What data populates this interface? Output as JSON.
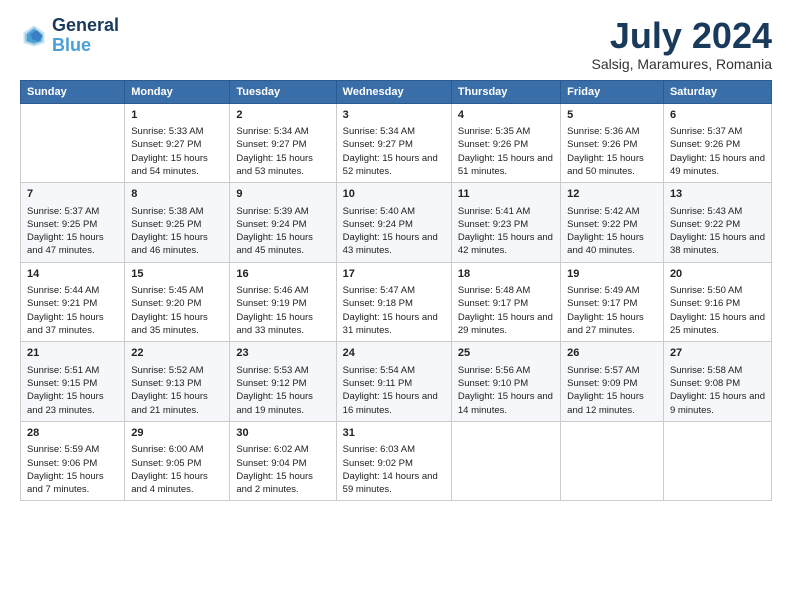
{
  "header": {
    "logo_line1": "General",
    "logo_line2": "Blue",
    "month": "July 2024",
    "location": "Salsig, Maramures, Romania"
  },
  "days_of_week": [
    "Sunday",
    "Monday",
    "Tuesday",
    "Wednesday",
    "Thursday",
    "Friday",
    "Saturday"
  ],
  "weeks": [
    [
      {
        "day": "",
        "sunrise": "",
        "sunset": "",
        "daylight": ""
      },
      {
        "day": "1",
        "sunrise": "Sunrise: 5:33 AM",
        "sunset": "Sunset: 9:27 PM",
        "daylight": "Daylight: 15 hours and 54 minutes."
      },
      {
        "day": "2",
        "sunrise": "Sunrise: 5:34 AM",
        "sunset": "Sunset: 9:27 PM",
        "daylight": "Daylight: 15 hours and 53 minutes."
      },
      {
        "day": "3",
        "sunrise": "Sunrise: 5:34 AM",
        "sunset": "Sunset: 9:27 PM",
        "daylight": "Daylight: 15 hours and 52 minutes."
      },
      {
        "day": "4",
        "sunrise": "Sunrise: 5:35 AM",
        "sunset": "Sunset: 9:26 PM",
        "daylight": "Daylight: 15 hours and 51 minutes."
      },
      {
        "day": "5",
        "sunrise": "Sunrise: 5:36 AM",
        "sunset": "Sunset: 9:26 PM",
        "daylight": "Daylight: 15 hours and 50 minutes."
      },
      {
        "day": "6",
        "sunrise": "Sunrise: 5:37 AM",
        "sunset": "Sunset: 9:26 PM",
        "daylight": "Daylight: 15 hours and 49 minutes."
      }
    ],
    [
      {
        "day": "7",
        "sunrise": "Sunrise: 5:37 AM",
        "sunset": "Sunset: 9:25 PM",
        "daylight": "Daylight: 15 hours and 47 minutes."
      },
      {
        "day": "8",
        "sunrise": "Sunrise: 5:38 AM",
        "sunset": "Sunset: 9:25 PM",
        "daylight": "Daylight: 15 hours and 46 minutes."
      },
      {
        "day": "9",
        "sunrise": "Sunrise: 5:39 AM",
        "sunset": "Sunset: 9:24 PM",
        "daylight": "Daylight: 15 hours and 45 minutes."
      },
      {
        "day": "10",
        "sunrise": "Sunrise: 5:40 AM",
        "sunset": "Sunset: 9:24 PM",
        "daylight": "Daylight: 15 hours and 43 minutes."
      },
      {
        "day": "11",
        "sunrise": "Sunrise: 5:41 AM",
        "sunset": "Sunset: 9:23 PM",
        "daylight": "Daylight: 15 hours and 42 minutes."
      },
      {
        "day": "12",
        "sunrise": "Sunrise: 5:42 AM",
        "sunset": "Sunset: 9:22 PM",
        "daylight": "Daylight: 15 hours and 40 minutes."
      },
      {
        "day": "13",
        "sunrise": "Sunrise: 5:43 AM",
        "sunset": "Sunset: 9:22 PM",
        "daylight": "Daylight: 15 hours and 38 minutes."
      }
    ],
    [
      {
        "day": "14",
        "sunrise": "Sunrise: 5:44 AM",
        "sunset": "Sunset: 9:21 PM",
        "daylight": "Daylight: 15 hours and 37 minutes."
      },
      {
        "day": "15",
        "sunrise": "Sunrise: 5:45 AM",
        "sunset": "Sunset: 9:20 PM",
        "daylight": "Daylight: 15 hours and 35 minutes."
      },
      {
        "day": "16",
        "sunrise": "Sunrise: 5:46 AM",
        "sunset": "Sunset: 9:19 PM",
        "daylight": "Daylight: 15 hours and 33 minutes."
      },
      {
        "day": "17",
        "sunrise": "Sunrise: 5:47 AM",
        "sunset": "Sunset: 9:18 PM",
        "daylight": "Daylight: 15 hours and 31 minutes."
      },
      {
        "day": "18",
        "sunrise": "Sunrise: 5:48 AM",
        "sunset": "Sunset: 9:17 PM",
        "daylight": "Daylight: 15 hours and 29 minutes."
      },
      {
        "day": "19",
        "sunrise": "Sunrise: 5:49 AM",
        "sunset": "Sunset: 9:17 PM",
        "daylight": "Daylight: 15 hours and 27 minutes."
      },
      {
        "day": "20",
        "sunrise": "Sunrise: 5:50 AM",
        "sunset": "Sunset: 9:16 PM",
        "daylight": "Daylight: 15 hours and 25 minutes."
      }
    ],
    [
      {
        "day": "21",
        "sunrise": "Sunrise: 5:51 AM",
        "sunset": "Sunset: 9:15 PM",
        "daylight": "Daylight: 15 hours and 23 minutes."
      },
      {
        "day": "22",
        "sunrise": "Sunrise: 5:52 AM",
        "sunset": "Sunset: 9:13 PM",
        "daylight": "Daylight: 15 hours and 21 minutes."
      },
      {
        "day": "23",
        "sunrise": "Sunrise: 5:53 AM",
        "sunset": "Sunset: 9:12 PM",
        "daylight": "Daylight: 15 hours and 19 minutes."
      },
      {
        "day": "24",
        "sunrise": "Sunrise: 5:54 AM",
        "sunset": "Sunset: 9:11 PM",
        "daylight": "Daylight: 15 hours and 16 minutes."
      },
      {
        "day": "25",
        "sunrise": "Sunrise: 5:56 AM",
        "sunset": "Sunset: 9:10 PM",
        "daylight": "Daylight: 15 hours and 14 minutes."
      },
      {
        "day": "26",
        "sunrise": "Sunrise: 5:57 AM",
        "sunset": "Sunset: 9:09 PM",
        "daylight": "Daylight: 15 hours and 12 minutes."
      },
      {
        "day": "27",
        "sunrise": "Sunrise: 5:58 AM",
        "sunset": "Sunset: 9:08 PM",
        "daylight": "Daylight: 15 hours and 9 minutes."
      }
    ],
    [
      {
        "day": "28",
        "sunrise": "Sunrise: 5:59 AM",
        "sunset": "Sunset: 9:06 PM",
        "daylight": "Daylight: 15 hours and 7 minutes."
      },
      {
        "day": "29",
        "sunrise": "Sunrise: 6:00 AM",
        "sunset": "Sunset: 9:05 PM",
        "daylight": "Daylight: 15 hours and 4 minutes."
      },
      {
        "day": "30",
        "sunrise": "Sunrise: 6:02 AM",
        "sunset": "Sunset: 9:04 PM",
        "daylight": "Daylight: 15 hours and 2 minutes."
      },
      {
        "day": "31",
        "sunrise": "Sunrise: 6:03 AM",
        "sunset": "Sunset: 9:02 PM",
        "daylight": "Daylight: 14 hours and 59 minutes."
      },
      {
        "day": "",
        "sunrise": "",
        "sunset": "",
        "daylight": ""
      },
      {
        "day": "",
        "sunrise": "",
        "sunset": "",
        "daylight": ""
      },
      {
        "day": "",
        "sunrise": "",
        "sunset": "",
        "daylight": ""
      }
    ]
  ]
}
